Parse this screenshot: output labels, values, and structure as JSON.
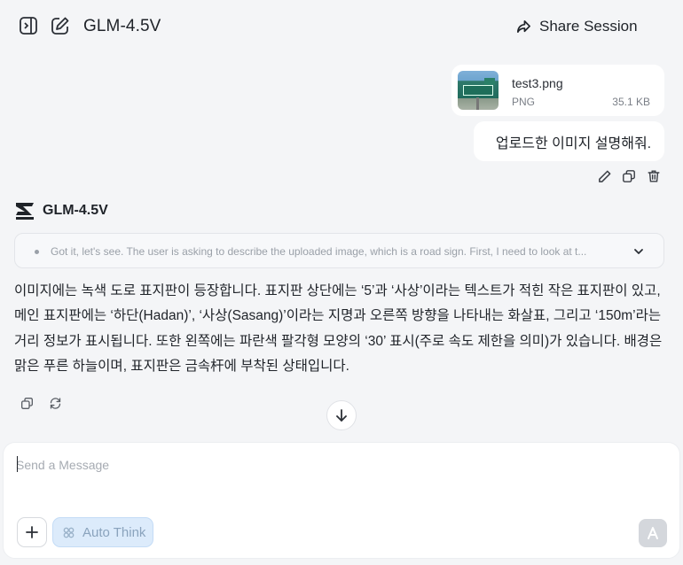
{
  "header": {
    "model_title": "GLM-4.5V",
    "share_label": "Share Session"
  },
  "user_message": {
    "attachment": {
      "file_name": "test3.png",
      "file_type": "PNG",
      "file_size": "35.1 KB"
    },
    "text": "업로드한 이미지 설명해줘."
  },
  "assistant": {
    "name": "GLM-4.5V",
    "thinking_preview": "Got it, let's see. The user is asking to describe the uploaded image, which is a road sign. First, I need to look at t...",
    "answer": "이미지에는 녹색 도로 표지판이 등장합니다. 표지판 상단에는 ‘5’과 ‘사상’이라는 텍스트가 적힌 작은 표지판이 있고, 메인 표지판에는 ‘하단(Hadan)’, ‘사상(Sasang)’이라는 지명과 오른쪽 방향을 나타내는 화살표, 그리고 ‘150m’라는 거리 정보가 표시됩니다. 또한 왼쪽에는 파란색 팔각형 모양의 ‘30’ 표시(주로 속도 제한을 의미)가 있습니다. 배경은 맑은 푸른 하늘이며, 표지판은 금속杆에 부착된 상태입니다."
  },
  "composer": {
    "placeholder": "Send a Message",
    "auto_think_label": "Auto Think"
  },
  "icons": {
    "sidebar_toggle": "sidebar-toggle-icon",
    "new_chat": "edit-icon",
    "share": "share-icon",
    "edit": "pencil-icon",
    "copy": "copy-icon",
    "delete": "trash-icon",
    "regenerate": "refresh-icon",
    "scroll_down": "arrow-down-icon",
    "plus": "plus-icon",
    "auto_think": "sparkle-icon",
    "send": "send-icon",
    "expand": "chevron-down-icon"
  },
  "colors": {
    "background": "#f4f5f7",
    "auto_think_bg": "#dcebfb",
    "send_disabled": "#d4d7dc"
  }
}
